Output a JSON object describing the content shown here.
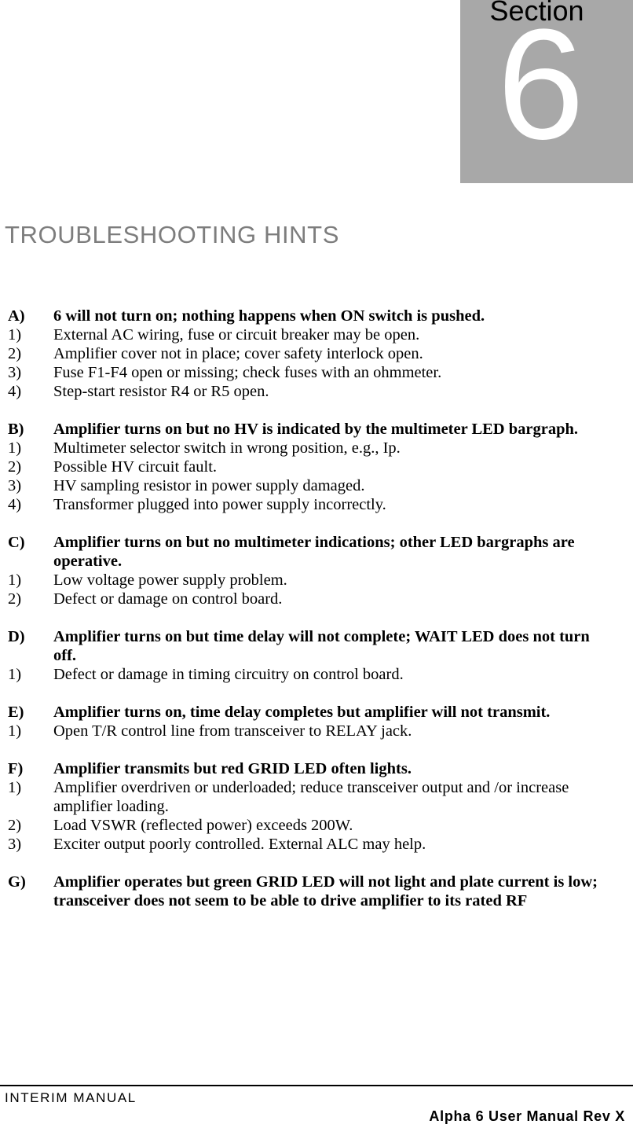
{
  "banner": {
    "word": "Section",
    "number": "6",
    "bg_color": "#a8a8a8",
    "number_color": "#ffffff",
    "word_color": "#000000"
  },
  "page_title": "TROUBLESHOOTING HINTS",
  "title_color": "#7d7d7d",
  "groups": [
    {
      "label": "A)",
      "heading": "6 will not turn on; nothing happens when ON switch is pushed.",
      "items": [
        {
          "label": "1)",
          "text": "External AC wiring, fuse or circuit breaker may be open."
        },
        {
          "label": "2)",
          "text": "Amplifier cover not in place;  cover safety interlock open."
        },
        {
          "label": "3)",
          "text": "Fuse F1-F4 open or missing;  check fuses with an ohmmeter."
        },
        {
          "label": "4)",
          "text": "Step-start resistor R4 or R5 open."
        }
      ]
    },
    {
      "label": "B)",
      "heading": "Amplifier turns on but no HV is indicated by the multimeter LED bargraph.",
      "items": [
        {
          "label": "1)",
          "text": "Multimeter selector switch in wrong position, e.g., Ip."
        },
        {
          "label": "2)",
          "text": "Possible HV circuit fault."
        },
        {
          "label": "3)",
          "text": "HV sampling resistor in power supply damaged."
        },
        {
          "label": "4)",
          "text": "Transformer plugged into power supply incorrectly."
        }
      ]
    },
    {
      "label": "C)",
      "heading": "Amplifier turns on but no multimeter indications;  other LED bargraphs are operative.",
      "items": [
        {
          "label": "1)",
          "text": "Low voltage power supply problem."
        },
        {
          "label": "2)",
          "text": "Defect or damage on control board."
        }
      ]
    },
    {
      "label": "D)",
      "heading": "Amplifier turns on but time delay will not complete;  WAIT LED does not turn off.",
      "items": [
        {
          "label": "1)",
          "text": "Defect or damage in timing circuitry on control board."
        }
      ]
    },
    {
      "label": "E)",
      "heading": "Amplifier turns on, time delay completes but amplifier will not transmit.",
      "items": [
        {
          "label": "1)",
          "text": "Open T/R control line from transceiver to RELAY jack."
        }
      ]
    },
    {
      "label": "F)",
      "heading": "Amplifier transmits but red GRID LED often lights.",
      "items": [
        {
          "label": "1)",
          "text": "Amplifier overdriven or underloaded;  reduce transceiver output and /or increase amplifier loading."
        },
        {
          "label": "2)",
          "text": "Load VSWR (reflected power) exceeds 200W."
        },
        {
          "label": "3)",
          "text": "Exciter output poorly controlled.  External ALC may help."
        }
      ]
    },
    {
      "label": "G)",
      "heading": "Amplifier operates but green GRID LED will not light and plate current is low;  transceiver does not seem to be able to drive amplifier to its rated RF",
      "items": []
    }
  ],
  "footer": {
    "left": "INTERIM MANUAL",
    "right": "Alpha 6 User Manual Rev X"
  }
}
